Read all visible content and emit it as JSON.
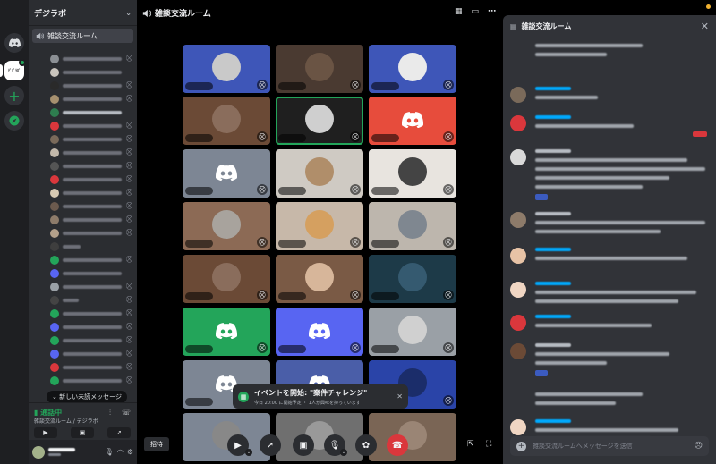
{
  "server": {
    "name": "デジラボ",
    "active_thumb_text": "ﾃﾞｼﾞﾗﾎﾞ"
  },
  "channel": {
    "name": "雑談交流ルーム",
    "new_messages_label": "新しい未読メッセージ"
  },
  "voice_status": {
    "status": "通話中",
    "location": "雑談交流ルーム / デジラボ"
  },
  "main": {
    "title": "雑談交流ルーム"
  },
  "event_banner": {
    "title": "イベントを開始: \"案件チャレンジ\"",
    "subtitle": "今日 20:00 に開始予定 ・ 1人が興味を持っています"
  },
  "controls": {
    "invite_label": "招待"
  },
  "chat": {
    "title": "雑談交流ルーム",
    "input_placeholder": "雑談交流ルームへメッセージを送信"
  },
  "colors": {
    "green": "#23a55a",
    "blurple": "#5865f2",
    "red": "#da373c",
    "bg_dark": "#1e1f22",
    "bg_side": "#2b2d31",
    "bg_chat": "#313338"
  }
}
